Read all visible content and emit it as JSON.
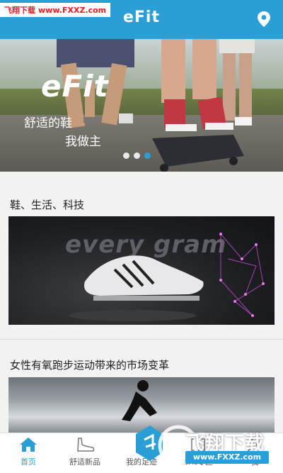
{
  "watermark_top": {
    "part1": "飞翔下载",
    "part2": "www.FXXZ.com"
  },
  "header": {
    "title": "eFit",
    "location_icon": "map-pin-icon"
  },
  "banner": {
    "logo": "eFit",
    "line1": "舒适的鞋",
    "line2": "我做主",
    "slides": 3,
    "active_slide": 3
  },
  "feed": [
    {
      "title": "鞋、生活、科技",
      "image_text": "every gram"
    },
    {
      "title": "女性有氧跑步运动带来的市场变革"
    }
  ],
  "nav": [
    {
      "label": "首页",
      "icon": "home-icon",
      "active": true
    },
    {
      "label": "舒适新品",
      "icon": "shoe-icon",
      "active": false
    },
    {
      "label": "我的足迹",
      "icon": "footprint-icon",
      "active": false
    },
    {
      "label": "eFit专区",
      "icon": "zone-icon",
      "active": false
    },
    {
      "label": "我",
      "icon": "user-icon",
      "active": false
    }
  ],
  "watermark_bottom": {
    "text": "飞翔下载",
    "url": "www.FXXZ.com"
  },
  "colors": {
    "primary": "#2a9fd6",
    "badge_red": "#e51b1b"
  }
}
